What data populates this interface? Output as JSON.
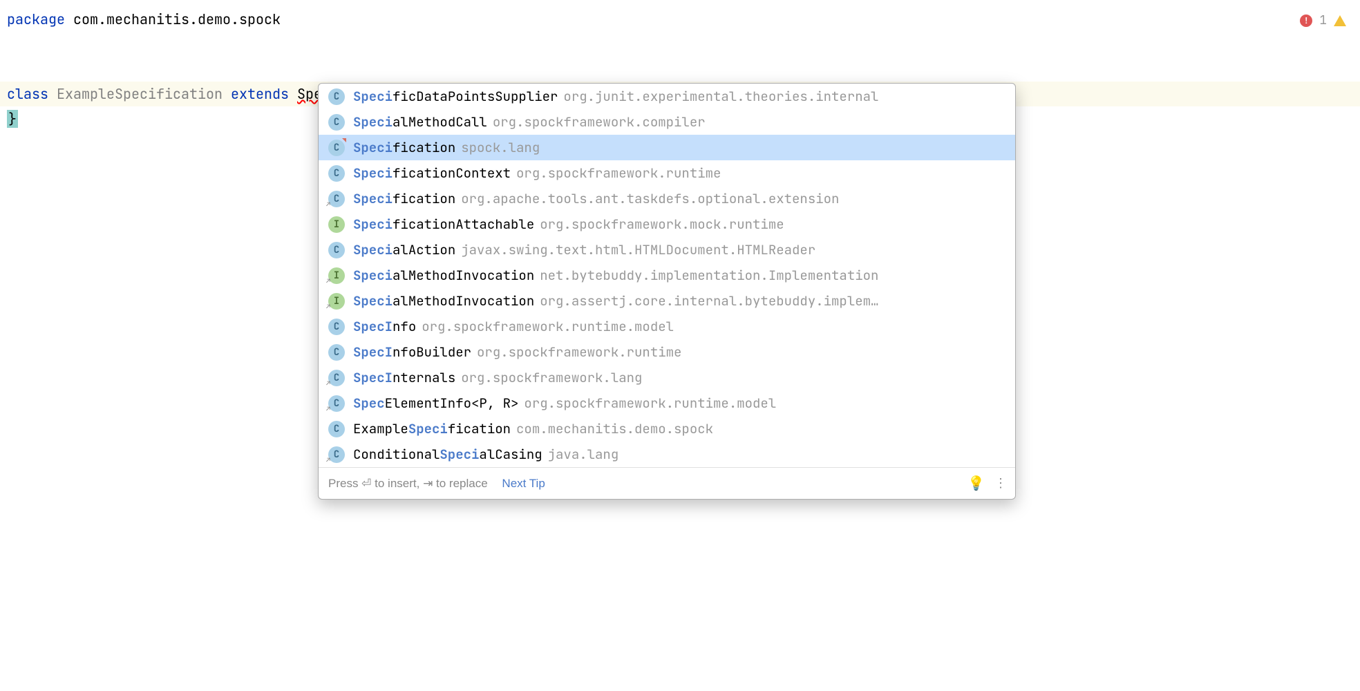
{
  "code": {
    "package_kw": "package",
    "package_name": " com.mechanitis.demo.spock",
    "class_kw": "class",
    "class_name": " ExampleSpecification ",
    "extends_kw": "extends",
    "extends_underscore": " ",
    "typed": "Speci",
    "open_brace": "{",
    "close_brace": "}"
  },
  "error_count": "1",
  "completions": [
    {
      "icon": "C",
      "iconType": "c",
      "badge": "",
      "pre": "",
      "match": "Speci",
      "post": "ficDataPointsSupplier",
      "pkg": "org.junit.experimental.theories.internal",
      "selected": false
    },
    {
      "icon": "C",
      "iconType": "c",
      "badge": "",
      "pre": "",
      "match": "Speci",
      "post": "alMethodCall",
      "pkg": "org.spockframework.compiler",
      "selected": false
    },
    {
      "icon": "C",
      "iconType": "c",
      "badge": "corner",
      "pre": "",
      "match": "Speci",
      "post": "fication",
      "pkg": "spock.lang",
      "selected": true
    },
    {
      "icon": "C",
      "iconType": "c",
      "badge": "",
      "pre": "",
      "match": "Speci",
      "post": "ficationContext",
      "pkg": "org.spockframework.runtime",
      "selected": false
    },
    {
      "icon": "C",
      "iconType": "c",
      "badge": "arrow",
      "pre": "",
      "match": "Speci",
      "post": "fication",
      "pkg": "org.apache.tools.ant.taskdefs.optional.extension",
      "selected": false
    },
    {
      "icon": "I",
      "iconType": "i",
      "badge": "",
      "pre": "",
      "match": "Speci",
      "post": "ficationAttachable",
      "pkg": "org.spockframework.mock.runtime",
      "selected": false
    },
    {
      "icon": "C",
      "iconType": "c",
      "badge": "",
      "pre": "",
      "match": "Speci",
      "post": "alAction",
      "pkg": "javax.swing.text.html.HTMLDocument.HTMLReader",
      "selected": false
    },
    {
      "icon": "I",
      "iconType": "i",
      "badge": "arrow",
      "pre": "",
      "match": "Speci",
      "post": "alMethodInvocation",
      "pkg": "net.bytebuddy.implementation.Implementation",
      "selected": false
    },
    {
      "icon": "I",
      "iconType": "i",
      "badge": "arrow",
      "pre": "",
      "match": "Speci",
      "post": "alMethodInvocation",
      "pkg": "org.assertj.core.internal.bytebuddy.implem…",
      "selected": false
    },
    {
      "icon": "C",
      "iconType": "c",
      "badge": "",
      "pre": "",
      "match": "SpecI",
      "post": "nfo",
      "pkg": "org.spockframework.runtime.model",
      "selected": false
    },
    {
      "icon": "C",
      "iconType": "c",
      "badge": "",
      "pre": "",
      "match": "SpecI",
      "post": "nfoBuilder",
      "pkg": "org.spockframework.runtime",
      "selected": false
    },
    {
      "icon": "C",
      "iconType": "c",
      "badge": "arrow",
      "pre": "",
      "match": "SpecI",
      "post": "nternals",
      "pkg": "org.spockframework.lang",
      "selected": false
    },
    {
      "icon": "C",
      "iconType": "c",
      "badge": "arrow",
      "pre": "",
      "match": "Spec",
      "post": "ElementInfo<P, R>",
      "pkg": "org.spockframework.runtime.model",
      "selected": false
    },
    {
      "icon": "C",
      "iconType": "c",
      "badge": "",
      "pre": "Example",
      "match": "Speci",
      "post": "fication",
      "pkg": "com.mechanitis.demo.spock",
      "selected": false
    },
    {
      "icon": "C",
      "iconType": "c",
      "badge": "arrow",
      "pre": "Conditional",
      "match": "Speci",
      "post": "alCasing",
      "pkg": "java.lang",
      "selected": false
    }
  ],
  "footer": {
    "hint": "Press ⏎ to insert, ⇥ to replace",
    "next_tip": "Next Tip"
  }
}
